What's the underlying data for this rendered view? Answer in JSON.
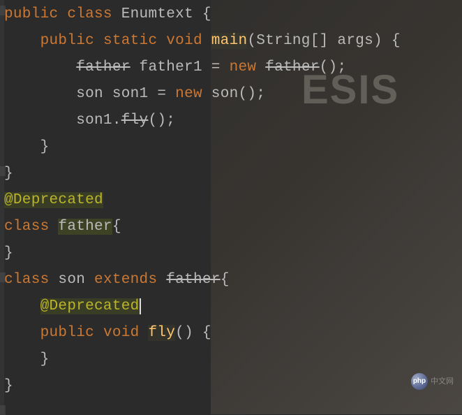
{
  "code": {
    "line1": {
      "kw1": "public",
      "kw2": "class",
      "className": "Enumtext",
      "brace": "{"
    },
    "line2": {
      "kw1": "public",
      "kw2": "static",
      "kw3": "void",
      "method": "main",
      "paramType": "String[]",
      "paramName": "args",
      "brace": "{"
    },
    "line3": {
      "type": "father",
      "varName": "father1",
      "op": "=",
      "kw": "new",
      "ctor": "father",
      "end": "();"
    },
    "line4": {
      "type": "son",
      "varName": "son1",
      "op": "=",
      "kw": "new",
      "ctor": "son",
      "end": "();"
    },
    "line5": {
      "obj": "son1",
      "dot": ".",
      "method": "fly",
      "end": "();"
    },
    "line6": {
      "brace": "}"
    },
    "line7": {
      "brace": "}"
    },
    "line8": {
      "annotation": "@Deprecated"
    },
    "line9": {
      "kw": "class",
      "className": "father",
      "brace": "{"
    },
    "line10": {
      "brace": "}"
    },
    "line11": {
      "kw1": "class",
      "className": "son",
      "kw2": "extends",
      "superClass": "father",
      "brace": "{"
    },
    "line12": {
      "annotation": "@Deprecated"
    },
    "line13": {
      "kw1": "public",
      "kw2": "void",
      "method": "fly",
      "parens": "()",
      "brace": "{"
    },
    "line14": {
      "brace": "}"
    },
    "line15": {
      "brace": "}"
    }
  },
  "watermark": {
    "logoAbbr": "php",
    "logoText": "中文网"
  },
  "bgText": "ESIS"
}
